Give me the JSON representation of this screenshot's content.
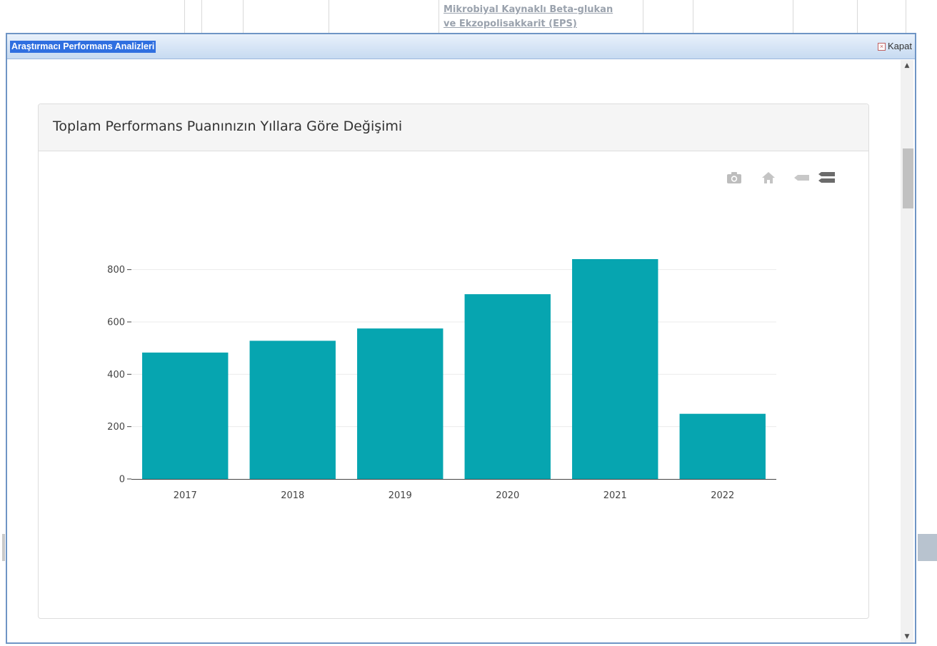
{
  "background": {
    "link_line1": "Mikrobiyal Kaynaklı Beta-glukan",
    "link_line2": "ve Ekzopolisakkarit (EPS)"
  },
  "dialog": {
    "title": "Araştırmacı Performans Analizleri",
    "close_label": "Kapat"
  },
  "panel": {
    "title": "Toplam Performans Puanınızın Yıllara Göre Değişimi"
  },
  "modebar": {
    "icons": [
      "camera-icon",
      "home-icon",
      "tag-icon",
      "compare-icon"
    ]
  },
  "colors": {
    "bar": "#06a5b0",
    "title_highlight": "#2f6fe0",
    "dialog_border": "#6f95c5"
  },
  "chart_data": {
    "type": "bar",
    "categories": [
      "2017",
      "2018",
      "2019",
      "2020",
      "2021",
      "2022"
    ],
    "values": [
      483,
      528,
      575,
      706,
      840,
      249
    ],
    "ylim": [
      0,
      900
    ],
    "yticks": [
      0,
      200,
      400,
      600,
      800
    ],
    "grid": true,
    "title": "",
    "xlabel": "",
    "ylabel": ""
  }
}
